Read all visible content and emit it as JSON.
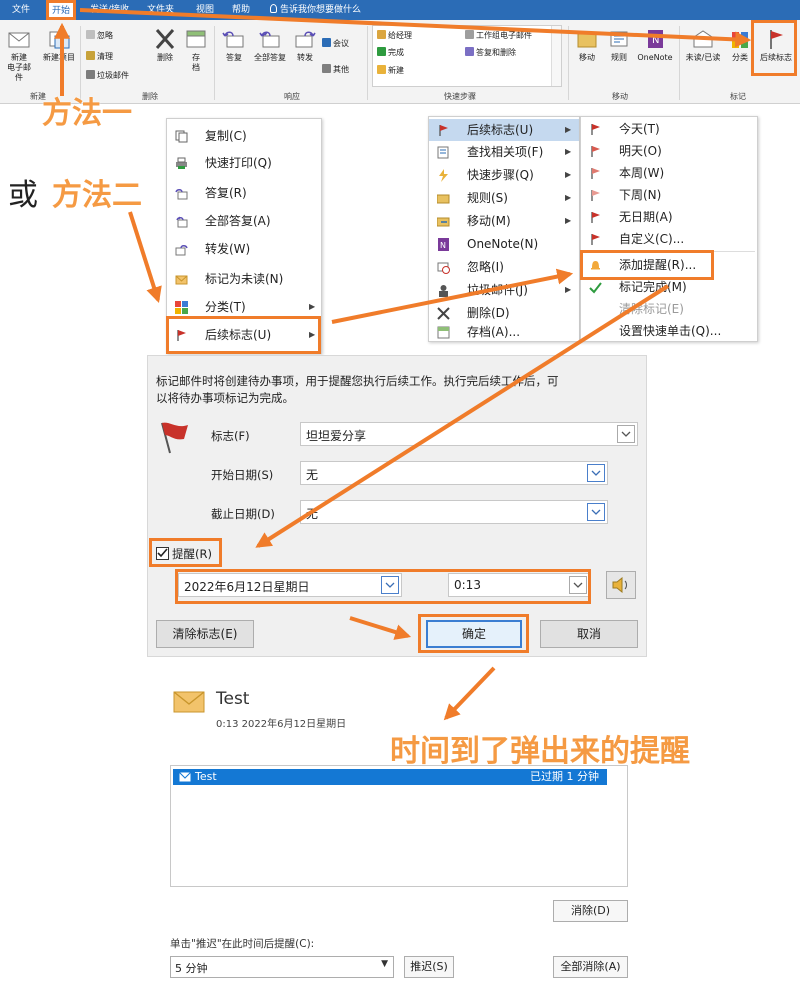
{
  "ribbon": {
    "tabs": [
      "文件",
      "开始",
      "发送/接收",
      "文件夹",
      "视图",
      "帮助"
    ],
    "tell_me": "告诉我你想要做什么",
    "buttons": {
      "new_email": "新建\n电子邮件",
      "new_items": "新建项目",
      "ignore": "忽略",
      "clean_up": "清理",
      "junk": "垃圾邮件",
      "delete": "删除",
      "archive": "存\n档",
      "reply": "答复",
      "reply_all": "全部答复",
      "forward": "转发",
      "meeting": "会议",
      "more": "其他",
      "qs_manager": "给经理",
      "qs_done": "完成",
      "qs_new": "新建",
      "qs_team": "工作组电子邮件",
      "qs_reply_delete": "答复和删除",
      "move": "移动",
      "rules": "规则",
      "onenote": "OneNote",
      "unread_read": "未读/已读",
      "categorize": "分类",
      "follow_up": "后续标志"
    },
    "groups": {
      "new": "新建",
      "delete": "删除",
      "respond": "响应",
      "quick_steps": "快速步骤",
      "move": "移动",
      "tags": "标记"
    }
  },
  "annotations": {
    "method1": "方法一",
    "or": "或",
    "method2": "方法二",
    "popup": "时间到了弹出来的提醒"
  },
  "context_menu": {
    "items": [
      {
        "label": "复制(C)",
        "icon": "copy-icon"
      },
      {
        "label": "快速打印(Q)",
        "icon": "print-icon"
      },
      {
        "label": "答复(R)",
        "icon": "reply-icon"
      },
      {
        "label": "全部答复(A)",
        "icon": "reply-all-icon"
      },
      {
        "label": "转发(W)",
        "icon": "forward-icon"
      },
      {
        "label": "标记为未读(N)",
        "icon": "envelope-icon"
      },
      {
        "label": "分类(T)",
        "icon": "category-icon"
      },
      {
        "label": "后续标志(U)",
        "icon": "flag-icon"
      }
    ]
  },
  "submenu_a": {
    "items": [
      {
        "label": "后续标志(U)",
        "icon": "flag-icon"
      },
      {
        "label": "查找相关项(F)",
        "icon": "find-icon"
      },
      {
        "label": "快速步骤(Q)",
        "icon": "lightning-icon"
      },
      {
        "label": "规则(S)",
        "icon": "rules-icon"
      },
      {
        "label": "移动(M)",
        "icon": "move-icon"
      },
      {
        "label": "OneNote(N)",
        "icon": "onenote-icon"
      },
      {
        "label": "忽略(I)",
        "icon": "ignore-icon"
      },
      {
        "label": "垃圾邮件(J)",
        "icon": "junk-icon"
      },
      {
        "label": "删除(D)",
        "icon": "delete-icon"
      },
      {
        "label": "存档(A)...",
        "icon": "archive-icon"
      }
    ]
  },
  "submenu_b": {
    "items": [
      {
        "label": "今天(T)",
        "icon": "flag-icon"
      },
      {
        "label": "明天(O)",
        "icon": "flag-icon"
      },
      {
        "label": "本周(W)",
        "icon": "flag-icon"
      },
      {
        "label": "下周(N)",
        "icon": "flag-icon"
      },
      {
        "label": "无日期(A)",
        "icon": "flag-icon"
      },
      {
        "label": "自定义(C)...",
        "icon": "flag-icon"
      },
      {
        "label": "添加提醒(R)...",
        "icon": "bell-icon"
      },
      {
        "label": "标记完成(M)",
        "icon": "check-icon"
      },
      {
        "label": "清除标记(E)",
        "icon": ""
      },
      {
        "label": "设置快速单击(Q)...",
        "icon": ""
      }
    ]
  },
  "dialog": {
    "desc_line1": "标记邮件时将创建待办事项，用于提醒您执行后续工作。执行完后续工作后，可",
    "desc_line2": "以将待办事项标记为完成。",
    "flag_label": "标志(F)",
    "flag_value": "坦坦爱分享",
    "start_label": "开始日期(S)",
    "start_value": "无",
    "due_label": "截止日期(D)",
    "due_value": "无",
    "reminder_label": "提醒(R)",
    "reminder_checked": true,
    "reminder_date": "2022年6月12日星期日",
    "reminder_time": "0:13",
    "clear_button": "清除标志(E)",
    "ok_button": "确定",
    "cancel_button": "取消"
  },
  "reminder": {
    "subject": "Test",
    "time": "0:13 2022年6月12日星期日",
    "list_subject": "Test",
    "list_due": "已过期 1 分钟",
    "dismiss_button": "消除(D)",
    "snooze_hint": "单击\"推迟\"在此时间后提醒(C):",
    "snooze_value": "5 分钟",
    "snooze_button": "推迟(S)",
    "dismiss_all_button": "全部消除(A)"
  },
  "colors": {
    "accent_orange": "#f07c2a",
    "ribbon_blue": "#2b6cb6",
    "flag_red": "#c8322a",
    "selection_blue": "#1478d4"
  }
}
